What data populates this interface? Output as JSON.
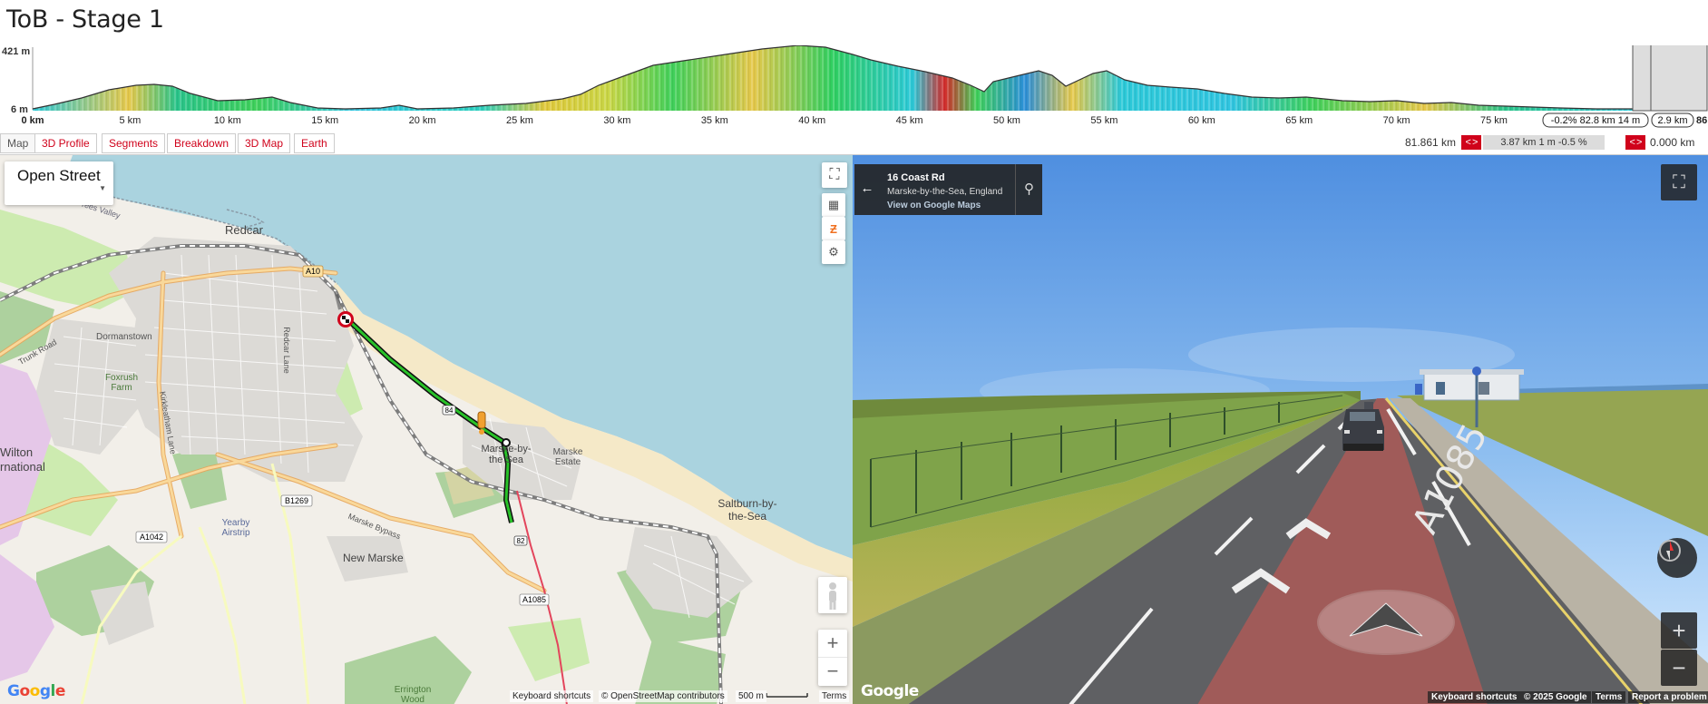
{
  "page": {
    "title": "ToB - Stage 1"
  },
  "profile": {
    "max_label": "421 m",
    "min_label": "6 m",
    "ticks": [
      "0 km",
      "5 km",
      "10 km",
      "15 km",
      "20 km",
      "25 km",
      "30 km",
      "35 km",
      "40 km",
      "45 km",
      "50 km",
      "55 km",
      "60 km",
      "65 km",
      "70 km",
      "75 km"
    ],
    "info_box": "-0.2% 82.8 km 14 m",
    "dist_box": "2.9 km",
    "end_tick": "86"
  },
  "tabs": [
    "Map",
    "3D Profile",
    "Segments",
    "Breakdown",
    "3D Map",
    "Earth"
  ],
  "controls": {
    "left_km": "81.861 km",
    "arrows": "< >",
    "segment": "3.87 km 1 m -0.5 %",
    "right_km": "0.000 km"
  },
  "map": {
    "layer_select": "Open Street",
    "places": {
      "redcar": "Redcar",
      "dormanstown": "Dormanstown",
      "foxrush": "Foxrush Farm",
      "wilton": "Wilton",
      "wilton2": "rnational",
      "marske": "Marske-by-the Sea",
      "marske_estate": "Marske Estate",
      "saltburn": "Saltburn-by-the-Sea",
      "new_marske": "New Marske",
      "yearby": "Yearby Airstrip",
      "errington": "Errington Wood",
      "tees_valley": "Tees Valley",
      "trunk_road": "Trunk Road",
      "marske_bypass": "Marske Bypass",
      "redcar_lane": "Redcar Lane",
      "kirkleatham": "Kirkleatham Lane",
      "a1042": "A1042",
      "b1269": "B1269",
      "a1085": "A1085",
      "a10": "A10",
      "km84": "84",
      "km82": "82"
    },
    "attribution": {
      "google": "Google",
      "shortcuts": "Keyboard shortcuts",
      "osm": "© OpenStreetMap contributors",
      "scale": "500 m",
      "terms": "Terms"
    },
    "zoom_in": "+",
    "zoom_out": "−"
  },
  "streetview": {
    "street": "16 Coast Rd",
    "city": "Marske-by-the-Sea, England",
    "link": "View on Google Maps",
    "road_marking": "A1085",
    "attribution": {
      "google": "Google",
      "shortcuts": "Keyboard shortcuts",
      "copyright": "© 2025 Google",
      "terms": "Terms",
      "report": "Report a problem"
    },
    "zoom_in": "+",
    "zoom_out": "−"
  },
  "colors": {
    "accent": "#d0021b",
    "sea": "#aad3df",
    "route": "#1b7f1b"
  }
}
